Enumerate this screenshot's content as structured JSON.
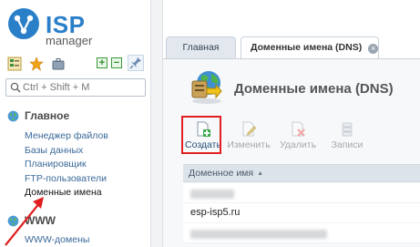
{
  "app": {
    "logo_isp": "ISP",
    "logo_manager": "manager"
  },
  "sidebar": {
    "search_placeholder": "Ctrl + Shift + M",
    "sections": [
      {
        "title": "Главное",
        "items": [
          {
            "label": "Менеджер файлов"
          },
          {
            "label": "Базы данных"
          },
          {
            "label": "Планировщик"
          },
          {
            "label": "FTP-пользователи"
          },
          {
            "label": "Доменные имена",
            "active": true
          }
        ]
      },
      {
        "title": "WWW",
        "items": [
          {
            "label": "WWW-домены"
          }
        ]
      }
    ]
  },
  "tabs": [
    {
      "label": "Главная",
      "active": false
    },
    {
      "label": "Доменные имена (DNS)",
      "active": true,
      "closable": true
    }
  ],
  "page": {
    "title": "Доменные имена (DNS)"
  },
  "toolbar": {
    "create": "Создать",
    "edit": "Изменить",
    "delete": "Удалить",
    "records": "Записи"
  },
  "table": {
    "columns": [
      "Доменное имя"
    ],
    "sort": "ascending",
    "rows": [
      {
        "domain": "",
        "redacted": true
      },
      {
        "domain": "esp-isp5.ru",
        "redacted": false
      },
      {
        "domain": "",
        "redacted": true
      }
    ]
  },
  "colors": {
    "accent": "#2a7fc9",
    "highlight": "#e02020",
    "link": "#3b6a9a"
  }
}
